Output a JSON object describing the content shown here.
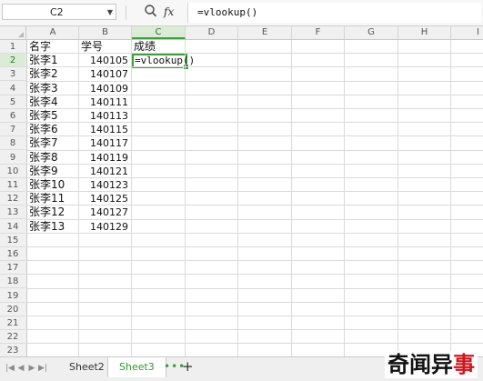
{
  "formula_bar": {
    "name_box": "C2",
    "fx_label": "fx",
    "formula": "=vlookup()"
  },
  "columns": [
    "A",
    "B",
    "C",
    "D",
    "E",
    "F",
    "G",
    "H",
    "I"
  ],
  "active_column": "C",
  "active_row": 2,
  "row_numbers": [
    "1",
    "2",
    "3",
    "4",
    "5",
    "6",
    "7",
    "8",
    "9",
    "10",
    "11",
    "12",
    "13",
    "14",
    "15",
    "16",
    "17",
    "18",
    "19",
    "20",
    "21",
    "22",
    "23"
  ],
  "sheet": {
    "headers": {
      "a": "名字",
      "b": "学号",
      "c": "成绩"
    },
    "rows": [
      {
        "name": "张李1",
        "id": "140105"
      },
      {
        "name": "张李2",
        "id": "140107"
      },
      {
        "name": "张李3",
        "id": "140109"
      },
      {
        "name": "张李4",
        "id": "140111"
      },
      {
        "name": "张李5",
        "id": "140113"
      },
      {
        "name": "张李6",
        "id": "140115"
      },
      {
        "name": "张李7",
        "id": "140117"
      },
      {
        "name": "张李8",
        "id": "140119"
      },
      {
        "name": "张李9",
        "id": "140121"
      },
      {
        "name": "张李10",
        "id": "140123"
      },
      {
        "name": "张李11",
        "id": "140125"
      },
      {
        "name": "张李12",
        "id": "140127"
      },
      {
        "name": "张李13",
        "id": "140129"
      }
    ],
    "c2_value": "=vlookup()"
  },
  "tabs": {
    "items": [
      "Sheet2",
      "Sheet3"
    ],
    "active": "Sheet3",
    "more": "•••",
    "add": "+"
  },
  "watermark": {
    "prefix": "奇闻异",
    "accent": "事"
  },
  "colors": {
    "accent_green": "#3f9d3f",
    "watermark_red": "#d0141b"
  }
}
